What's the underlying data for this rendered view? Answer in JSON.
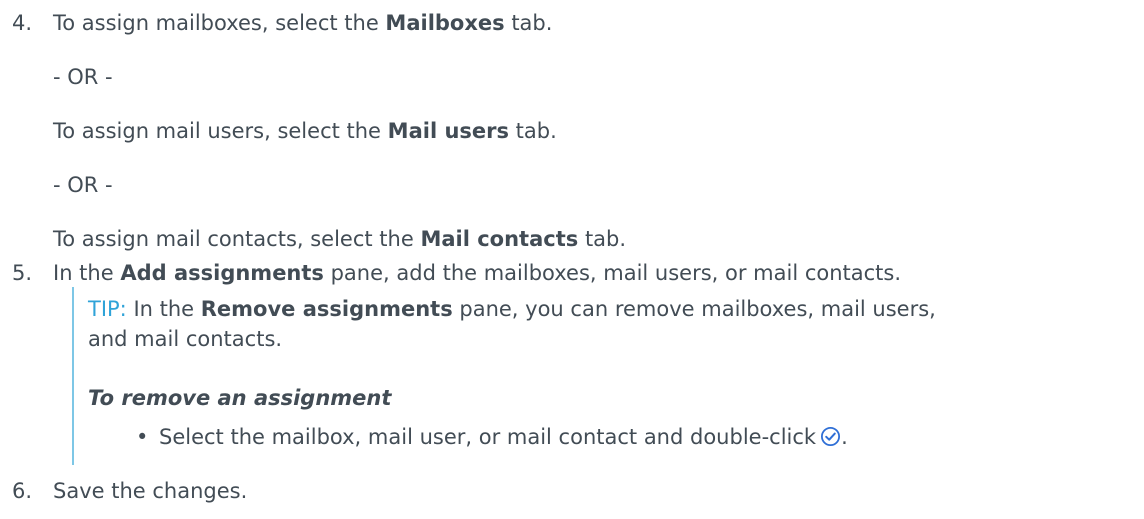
{
  "steps": {
    "step4": {
      "number": "4.",
      "line1": {
        "pre": "To assign mailboxes, select the ",
        "bold": "Mailboxes",
        "post": " tab."
      },
      "or1": "- OR -",
      "line2": {
        "pre": "To assign mail users, select the ",
        "bold": "Mail users",
        "post": " tab."
      },
      "or2": "- OR -",
      "line3": {
        "pre": "To assign mail contacts, select the ",
        "bold": "Mail contacts",
        "post": " tab."
      }
    },
    "step5": {
      "number": "5.",
      "pre": "In the ",
      "bold": "Add assignments",
      "post": " pane, add the mailboxes, mail users, or mail contacts."
    },
    "tip": {
      "label": "TIP:",
      "pre": " In the ",
      "bold": "Remove assignments",
      "post": " pane, you can remove mailboxes, mail users,",
      "line2": "and mail contacts.",
      "procedure_title": "To remove an assignment",
      "bullet_symbol": "•",
      "bullet_text": "Select the mailbox, mail user, or mail contact and double-click",
      "bullet_icon": "check-circle-icon",
      "bullet_end": "."
    },
    "step6": {
      "number": "6.",
      "text": "Save the changes."
    }
  },
  "colors": {
    "text": "#424c55",
    "tip_label": "#2fa3d8",
    "tip_bar": "#7ec7e6",
    "icon": "#2f6fd6"
  }
}
